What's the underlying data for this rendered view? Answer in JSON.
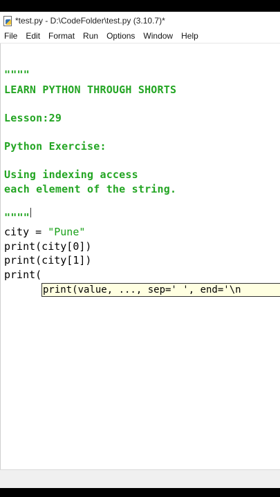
{
  "window": {
    "title": "*test.py - D:\\CodeFolder\\test.py (3.10.7)*"
  },
  "menu": [
    "File",
    "Edit",
    "Format",
    "Run",
    "Options",
    "Window",
    "Help"
  ],
  "editor": {
    "line1": "\"\"\"\"",
    "line2": "LEARN PYTHON THROUGH SHORTS",
    "line3": "Lesson:29",
    "line4": "Python Exercise:",
    "line5": "Using indexing access",
    "line6": "each element of the string.",
    "line7": "\"\"\"\"",
    "city_prefix": "city = ",
    "city_value": "\"Pune\"",
    "print1": "print(city[0])",
    "print2": "print(city[1])",
    "print3": "print("
  },
  "calltip": {
    "text": "print(value, ..., sep=' ', end='\\n"
  }
}
